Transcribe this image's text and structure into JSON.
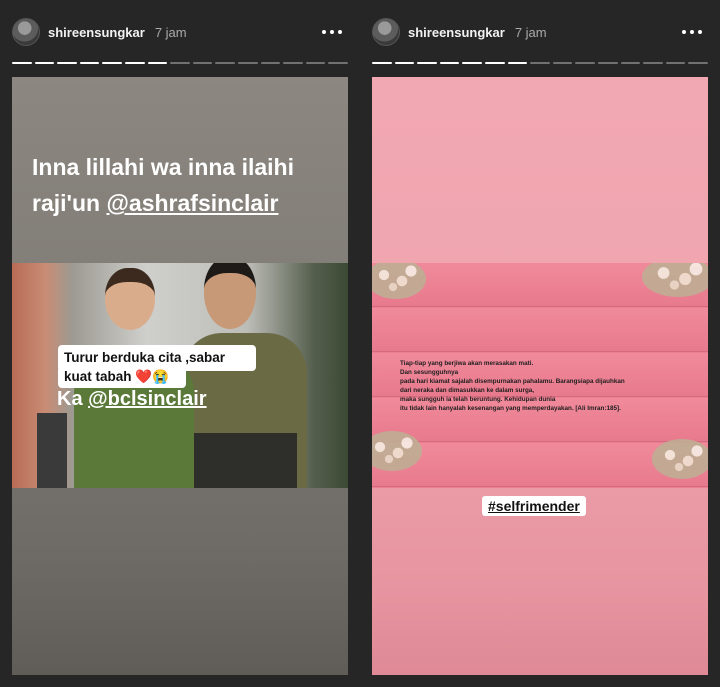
{
  "stories": [
    {
      "username": "shireensungkar",
      "time": "7 jam",
      "progress_segments": 15,
      "progress_done": 7,
      "caption_line1": "Inna lillahi wa inna ilaihi",
      "caption_line2_prefix": "raji'un ",
      "caption_mention": "@ashrafsinclair",
      "sticker_line1": "Turur berduka cita ,sabar",
      "sticker_line2": "kuat tabah",
      "sticker_emoji": "❤️😭",
      "ka_prefix": "Ka ",
      "ka_mention": "@bclsinclair"
    },
    {
      "username": "shireensungkar",
      "time": "7 jam",
      "progress_segments": 15,
      "progress_done": 7,
      "quote_lines": [
        "Tiap-tiap yang berjiwa akan merasakan mati.",
        "Dan sesungguhnya",
        "pada hari kiamat sajalah disempurnakan pahalamu. Barangsiapa dijauhkan",
        "dari neraka dan dimasukkan ke dalam surga,",
        "maka sungguh ia telah beruntung. Kehidupan dunia",
        "itu tidak lain hanyalah kesenangan yang memperdayakan. [Ali Imran:185]."
      ],
      "hashtag": "#selfrimender"
    }
  ],
  "colors": {
    "background": "#262626",
    "left_story_bg": "#827e78",
    "right_story_bg": "#efa4ae",
    "heart": "#d8202c"
  }
}
